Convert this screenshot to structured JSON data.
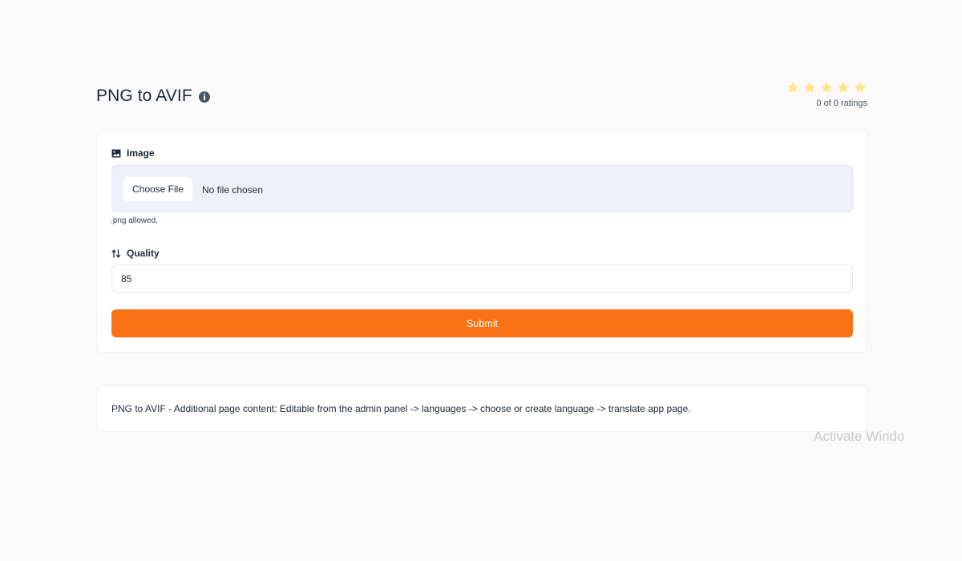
{
  "header": {
    "title": "PNG to AVIF",
    "info_icon": "info-circle-icon"
  },
  "rating": {
    "stars_total": 5,
    "stars_filled": 0,
    "star_color": "#fde68a",
    "text": "0 of 0 ratings"
  },
  "form": {
    "image_label": "Image",
    "image_icon": "image-icon",
    "choose_file_label": "Choose File",
    "file_status": "No file chosen",
    "allowed_hint": ".png allowed.",
    "quality_label": "Quality",
    "quality_icon": "sort-arrows-icon",
    "quality_value": "85",
    "submit_label": "Submit",
    "accent_color": "#f97316"
  },
  "content": {
    "text": "PNG to AVIF - Additional page content: Editable from the admin panel -> languages -> choose or create language -> translate app page."
  },
  "watermark": {
    "text": "Activate Windo"
  }
}
